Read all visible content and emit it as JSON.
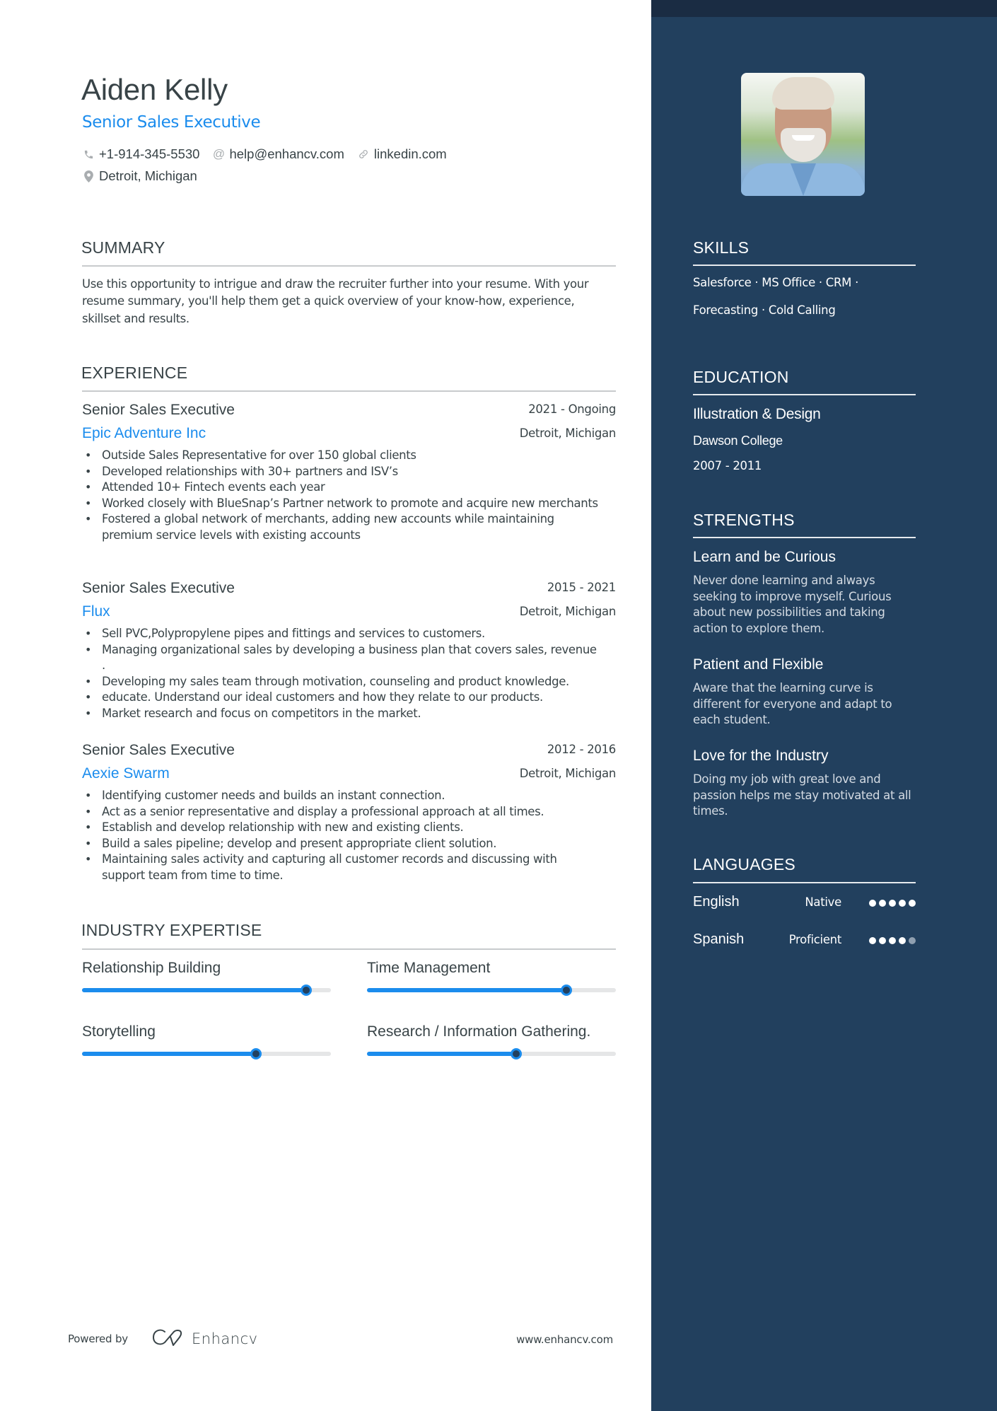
{
  "header": {
    "name": "Aiden Kelly",
    "title": "Senior Sales Executive",
    "contacts": [
      {
        "icon": "phone-icon",
        "text": "+1-914-345-5530"
      },
      {
        "icon": "at-icon",
        "text": "help@enhancv.com"
      },
      {
        "icon": "link-icon",
        "text": "linkedin.com"
      },
      {
        "icon": "location-pin-icon",
        "text": "Detroit, Michigan"
      }
    ]
  },
  "summary": {
    "heading": "SUMMARY",
    "text": "Use this opportunity to intrigue and draw the recruiter further into your resume. With your resume summary, you'll help them get a quick overview of your know-how, experience, skillset and results."
  },
  "experience": {
    "heading": "EXPERIENCE",
    "jobs": [
      {
        "role": "Senior Sales Executive",
        "dates": "2021 - Ongoing",
        "company": "Epic Adventure Inc",
        "location": "Detroit, Michigan",
        "bullets": [
          "Outside Sales Representative for over 150 global clients",
          "Developed relationships with 30+ partners and ISV’s",
          "Attended 10+ Fintech events each year",
          "Worked closely with BlueSnap’s Partner network to promote and acquire new merchants",
          "Fostered a global network of merchants, adding new accounts while maintaining premium service levels with existing accounts"
        ]
      },
      {
        "role": "Senior Sales Executive",
        "dates": "2015 - 2021",
        "company": "Flux",
        "location": "Detroit, Michigan",
        "bullets": [
          "Sell PVC,Polypropylene pipes and fittings and services to customers.",
          "Managing organizational sales by developing a business plan that covers sales, revenue .",
          "Developing my sales team through motivation, counseling and product knowledge.",
          "educate. Understand our ideal customers and how they relate to our products.",
          "Market research and focus on competitors in the market."
        ]
      },
      {
        "role": "Senior Sales Executive",
        "dates": "2012 - 2016",
        "company": "Aexie Swarm",
        "location": "Detroit, Michigan",
        "bullets": [
          "Identifying customer needs and builds an instant connection.",
          "Act as a senior representative and display a professional approach at all times.",
          "Establish and develop relationship with new and existing clients.",
          "Build a sales pipeline; develop and present appropriate client solution.",
          "Maintaining sales activity and capturing all customer records and discussing with support team from time to time."
        ]
      }
    ]
  },
  "expertise": {
    "heading": "INDUSTRY EXPERTISE",
    "items": [
      {
        "label": "Relationship Building",
        "level": 0.9
      },
      {
        "label": "Time Management",
        "level": 0.8
      },
      {
        "label": "Storytelling",
        "level": 0.7
      },
      {
        "label": "Research / Information Gathering.",
        "level": 0.6
      }
    ]
  },
  "footer": {
    "powered_by": "Powered by",
    "brand": "Enhancv",
    "url": "www.enhancv.com"
  },
  "sidebar": {
    "photo_alt": "Profile photo of smiling man with grey beard",
    "skills": {
      "heading": "SKILLS",
      "line1": "Salesforce · MS Office · CRM ·",
      "line2": "Forecasting · Cold Calling",
      "items": [
        "Salesforce",
        "MS Office",
        "CRM",
        "Forecasting",
        "Cold Calling"
      ]
    },
    "education": {
      "heading": "EDUCATION",
      "degree": "Illustration & Design",
      "school": "Dawson College",
      "dates": "2007 - 2011"
    },
    "strengths": {
      "heading": "STRENGTHS",
      "items": [
        {
          "title": "Learn and be Curious",
          "description": "Never done learning and always seeking to improve myself. Curious about new possibilities and taking action to explore them."
        },
        {
          "title": "Patient and Flexible",
          "description": "Aware that the learning curve is different for everyone and adapt to each student."
        },
        {
          "title": "Love for the Industry",
          "description": "Doing my job with great love and passion helps me stay motivated at all times."
        }
      ]
    },
    "languages": {
      "heading": "LANGUAGES",
      "items": [
        {
          "name": "English",
          "level": "Native",
          "rating": 5,
          "max": 5
        },
        {
          "name": "Spanish",
          "level": "Proficient",
          "rating": 4,
          "max": 5
        }
      ]
    }
  },
  "colors": {
    "accent": "#1b8ced",
    "sidebar_bg": "#22405e",
    "sidebar_top": "#1a2c43",
    "text": "#384347"
  }
}
